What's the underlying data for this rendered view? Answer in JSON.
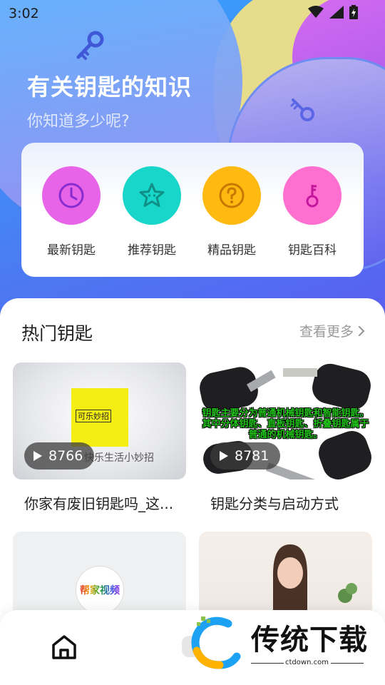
{
  "status_bar": {
    "time": "3:02"
  },
  "hero": {
    "title": "有关钥匙的知识",
    "subtitle": "你知道多少呢?"
  },
  "categories": [
    {
      "label": "最新钥匙",
      "icon": "clock-icon",
      "color": "#e763e8"
    },
    {
      "label": "推荐钥匙",
      "icon": "star-icon",
      "color": "#18d6c9"
    },
    {
      "label": "精品钥匙",
      "icon": "question-icon",
      "color": "#ffba12"
    },
    {
      "label": "钥匙百科",
      "icon": "key-icon",
      "color": "#ff6fcf"
    }
  ],
  "hot_section": {
    "title": "热门钥匙",
    "more": "查看更多"
  },
  "videos": [
    {
      "title": "你家有废旧钥匙吗_这...",
      "plays": "8766",
      "poster_text": "可乐妙招",
      "brand_text": "快乐生活小妙招"
    },
    {
      "title": "钥匙分类与启动方式",
      "plays": "8781",
      "overlay_text": "钥匙主要分为普通机械钥匙和智能钥匙。其中分体钥匙、直板钥匙、折叠钥匙属于普通的机械钥匙。"
    },
    {
      "title": "",
      "plays": "",
      "logo_text": "帮家视频"
    },
    {
      "title": "",
      "plays": ""
    }
  ],
  "bottom_nav": {
    "home_icon": "home-icon"
  },
  "watermark": {
    "text": "传统下载",
    "url": "ctdown.com"
  },
  "colors": {
    "accent": "#4a7df2",
    "play_pill": "#3c3c3c"
  }
}
